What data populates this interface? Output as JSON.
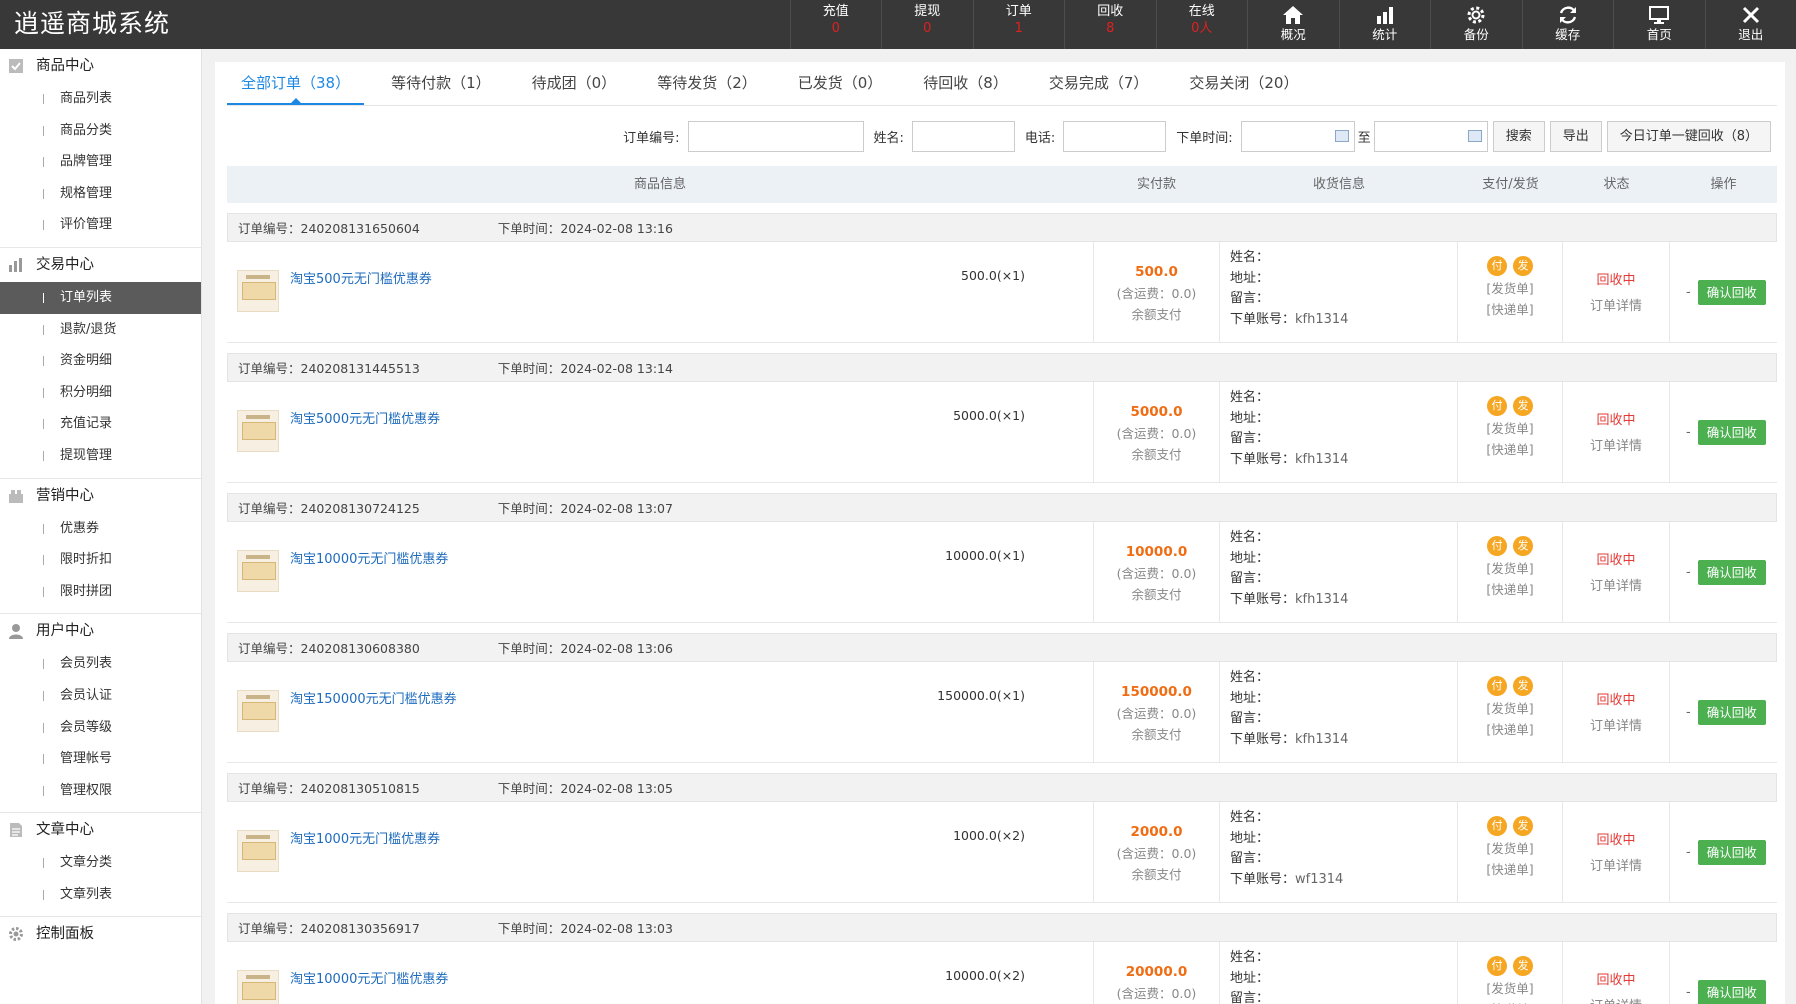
{
  "app": {
    "title": "逍遥商城系统"
  },
  "top_nav": {
    "stats": [
      {
        "label": "充值",
        "value": "0"
      },
      {
        "label": "提现",
        "value": "0"
      },
      {
        "label": "订单",
        "value": "1"
      },
      {
        "label": "回收",
        "value": "8"
      },
      {
        "label": "在线",
        "value": "0人"
      }
    ],
    "buttons": [
      {
        "label": "概况",
        "icon": "home-icon"
      },
      {
        "label": "统计",
        "icon": "bar-chart-icon"
      },
      {
        "label": "备份",
        "icon": "gear-icon"
      },
      {
        "label": "缓存",
        "icon": "refresh-icon"
      },
      {
        "label": "首页",
        "icon": "monitor-icon"
      },
      {
        "label": "退出",
        "icon": "close-icon"
      }
    ]
  },
  "sidebar": {
    "groups": [
      {
        "title": "商品中心",
        "icon": "goods-icon",
        "items": [
          "商品列表",
          "商品分类",
          "品牌管理",
          "规格管理",
          "评价管理"
        ]
      },
      {
        "title": "交易中心",
        "icon": "chart-icon",
        "items": [
          "订单列表",
          "退款/退货",
          "资金明细",
          "积分明细",
          "充值记录",
          "提现管理"
        ]
      },
      {
        "title": "营销中心",
        "icon": "marketing-icon",
        "items": [
          "优惠券",
          "限时折扣",
          "限时拼团"
        ]
      },
      {
        "title": "用户中心",
        "icon": "user-icon",
        "items": [
          "会员列表",
          "会员认证",
          "会员等级",
          "管理帐号",
          "管理权限"
        ]
      },
      {
        "title": "文章中心",
        "icon": "document-icon",
        "items": [
          "文章分类",
          "文章列表"
        ]
      },
      {
        "title": "控制面板",
        "icon": "settings-icon",
        "items": []
      }
    ],
    "active_item": "订单列表"
  },
  "tabs": [
    {
      "label": "全部订单（38）",
      "active": true
    },
    {
      "label": "等待付款（1）"
    },
    {
      "label": "待成团（0）"
    },
    {
      "label": "等待发货（2）"
    },
    {
      "label": "已发货（0）"
    },
    {
      "label": "待回收（8）"
    },
    {
      "label": "交易完成（7）"
    },
    {
      "label": "交易关闭（20）"
    }
  ],
  "filter": {
    "order_no_label": "订单编号:",
    "name_label": "姓名:",
    "phone_label": "电话:",
    "time_label": "下单时间:",
    "to_label": "至",
    "search_button": "搜索",
    "export_button": "导出",
    "recycle_all_button": "今日订单一键回收（8）"
  },
  "table": {
    "headers": [
      "商品信息",
      "实付款",
      "收货信息",
      "支付/发货",
      "状态",
      "操作"
    ]
  },
  "labels": {
    "order_no": "订单编号：",
    "order_time": "下单时间：",
    "freight": "(含运费：0.0)",
    "pay_method": "余额支付",
    "name": "姓名：",
    "address": "地址：",
    "note": "留言：",
    "account": "下单账号：",
    "pay_badge": "付",
    "ship_badge": "发",
    "ship_note": "[发货单]",
    "express_note": "[快递单]",
    "status": "回收中",
    "detail": "订单详情",
    "op_dash": "-",
    "confirm": "确认回收"
  },
  "orders": [
    {
      "no": "240208131650604",
      "time": "2024-02-08 13:16",
      "goods": "淘宝500元无门槛优惠券",
      "price": "500.0(×1)",
      "amount": "500.0",
      "account": "kfh1314"
    },
    {
      "no": "240208131445513",
      "time": "2024-02-08 13:14",
      "goods": "淘宝5000元无门槛优惠券",
      "price": "5000.0(×1)",
      "amount": "5000.0",
      "account": "kfh1314"
    },
    {
      "no": "240208130724125",
      "time": "2024-02-08 13:07",
      "goods": "淘宝10000元无门槛优惠券",
      "price": "10000.0(×1)",
      "amount": "10000.0",
      "account": "kfh1314"
    },
    {
      "no": "240208130608380",
      "time": "2024-02-08 13:06",
      "goods": "淘宝150000元无门槛优惠券",
      "price": "150000.0(×1)",
      "amount": "150000.0",
      "account": "kfh1314"
    },
    {
      "no": "240208130510815",
      "time": "2024-02-08 13:05",
      "goods": "淘宝1000元无门槛优惠券",
      "price": "1000.0(×2)",
      "amount": "2000.0",
      "account": "wf1314"
    },
    {
      "no": "240208130356917",
      "time": "2024-02-08 13:03",
      "goods": "淘宝10000元无门槛优惠券",
      "price": "10000.0(×2)",
      "amount": "20000.0",
      "account": ""
    }
  ]
}
